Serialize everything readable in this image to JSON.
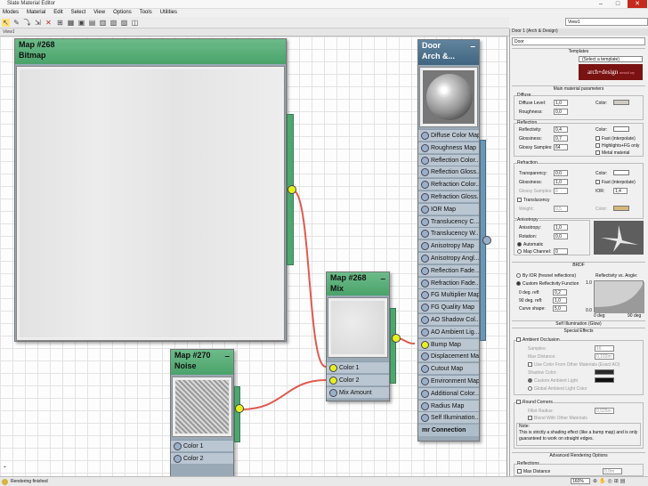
{
  "window": {
    "title": "Slate Material Editor"
  },
  "menu": [
    "Modes",
    "Material",
    "Edit",
    "Select",
    "View",
    "Options",
    "Tools",
    "Utilities"
  ],
  "view_selector": "View1",
  "view_tab": "View1",
  "nodes": {
    "bitmap": {
      "title_line1": "Map #268",
      "title_line2": "Bitmap"
    },
    "mix": {
      "title_line1": "Map #268",
      "title_line2": "Mix",
      "slots": [
        "Color 1",
        "Color 2",
        "Mix Amount"
      ]
    },
    "noise": {
      "title_line1": "Map #270",
      "title_line2": "Noise",
      "slots": [
        "Color 1",
        "Color 2"
      ]
    },
    "door": {
      "title_line1": "Door",
      "title_line2": "Arch &...",
      "slots": [
        "Diffuse Color Map",
        "Roughness Map",
        "Reflection Color...",
        "Reflection Gloss...",
        "Refraction Color...",
        "Refraction Gloss...",
        "IOR Map",
        "Translucency C...",
        "Translucency W...",
        "Anisotropy Map",
        "Anisotropy Angl...",
        "Reflection Fade...",
        "Refraction Fade...",
        "FG Multiplier Map",
        "FG Quality Map",
        "AO Shadow Col...",
        "AO Ambient Lig...",
        "Bump Map",
        "Displacement Map",
        "Cutout Map",
        "Environment Map",
        "Additional Color...",
        "Radius Map",
        "Self Illumination..."
      ],
      "footer": "mr Connection"
    }
  },
  "right_panel": {
    "title": "Door 1 (Arch & Design)",
    "name_field": "Door",
    "templates": {
      "header": "Templates",
      "select_placeholder": "(Select a template)",
      "logo_text": "arch+design",
      "logo_sub": "mental ray"
    },
    "main_params": {
      "header": "Main material parameters",
      "diffuse": {
        "group": "Diffuse",
        "level_label": "Diffuse Level:",
        "level": "1,0",
        "rough_label": "Roughness:",
        "rough": "0,0",
        "color_label": "Color:",
        "color": "#cfcbc5"
      },
      "reflection": {
        "group": "Reflection",
        "refl_label": "Reflectivity:",
        "refl": "0,4",
        "gloss_label": "Glossiness:",
        "gloss": "0,7",
        "samples_label": "Glossy Samples:",
        "samples": "64",
        "color_label": "Color:",
        "fast": "Fast (interpolate)",
        "highlights": "Highlights+FG only",
        "metal": "Metal material"
      },
      "refraction": {
        "group": "Refraction",
        "trans_label": "Transparency:",
        "trans": "0,0",
        "gloss_label": "Glossiness:",
        "gloss": "1,0",
        "samples_label": "Glossy Samples:",
        "samples": "8",
        "color_label": "Color:",
        "fast": "Fast (interpolate)",
        "ior_label": "IOR:",
        "ior": "1,4"
      },
      "translucency": {
        "label": "Translucency",
        "weight_label": "Weight:",
        "weight": "0,5",
        "color_label": "Color:",
        "color": "#d8b878"
      },
      "anisotropy": {
        "group": "Anisotropy",
        "aniso_label": "Anisotropy:",
        "aniso": "1,0",
        "rot_label": "Rotation:",
        "rot": "0,0",
        "automatic": "Automatic",
        "map_channel": "Map Channel:",
        "map_channel_val": "0"
      }
    },
    "brdf": {
      "header": "BRDF",
      "by_ior": "By IOR (fresnel reflections)",
      "custom": "Custom Reflectivity Function",
      "deg0_label": "0 deg. refl:",
      "deg0": "0,2",
      "deg90_label": "90 deg. refl:",
      "deg90": "1,0",
      "curve_label": "Curve shape:",
      "curve": "5,0",
      "graph_title": "Reflectivity vs. Angle:",
      "y_top": "1.0",
      "y_bot": "0.0",
      "x_left": "0 deg",
      "x_right": "90 deg"
    },
    "self_illum": "Self Illumination (Glow)",
    "special_effects": {
      "header": "Special Effects",
      "ao": "Ambient Occlusion",
      "samples_label": "Samples:",
      "samples": "16",
      "maxdist_label": "Max Distance:",
      "maxdist": "0,102m",
      "use_color": "Use Color From Other Materials (Exact AO)",
      "shadow_label": "Shadow Color:",
      "custom_ambient": "Custom Ambient Light",
      "global_ambient": "Global Ambient Light Color",
      "round": "Round Corners",
      "fillet_label": "Fillet Radius:",
      "fillet": "0,025m",
      "blend": "Blend With Other Materials",
      "note_label": "Note:",
      "note": "This is strictly a shading effect (like a bump map) and is only guaranteed to work on straight edges."
    },
    "advanced": {
      "header": "Advanced Rendering Options",
      "reflections": "Reflections",
      "max_distance": "Max Distance",
      "max_distance_val": "0,0m"
    }
  },
  "status": {
    "text": "Rendering finished",
    "zoom": "160%"
  }
}
